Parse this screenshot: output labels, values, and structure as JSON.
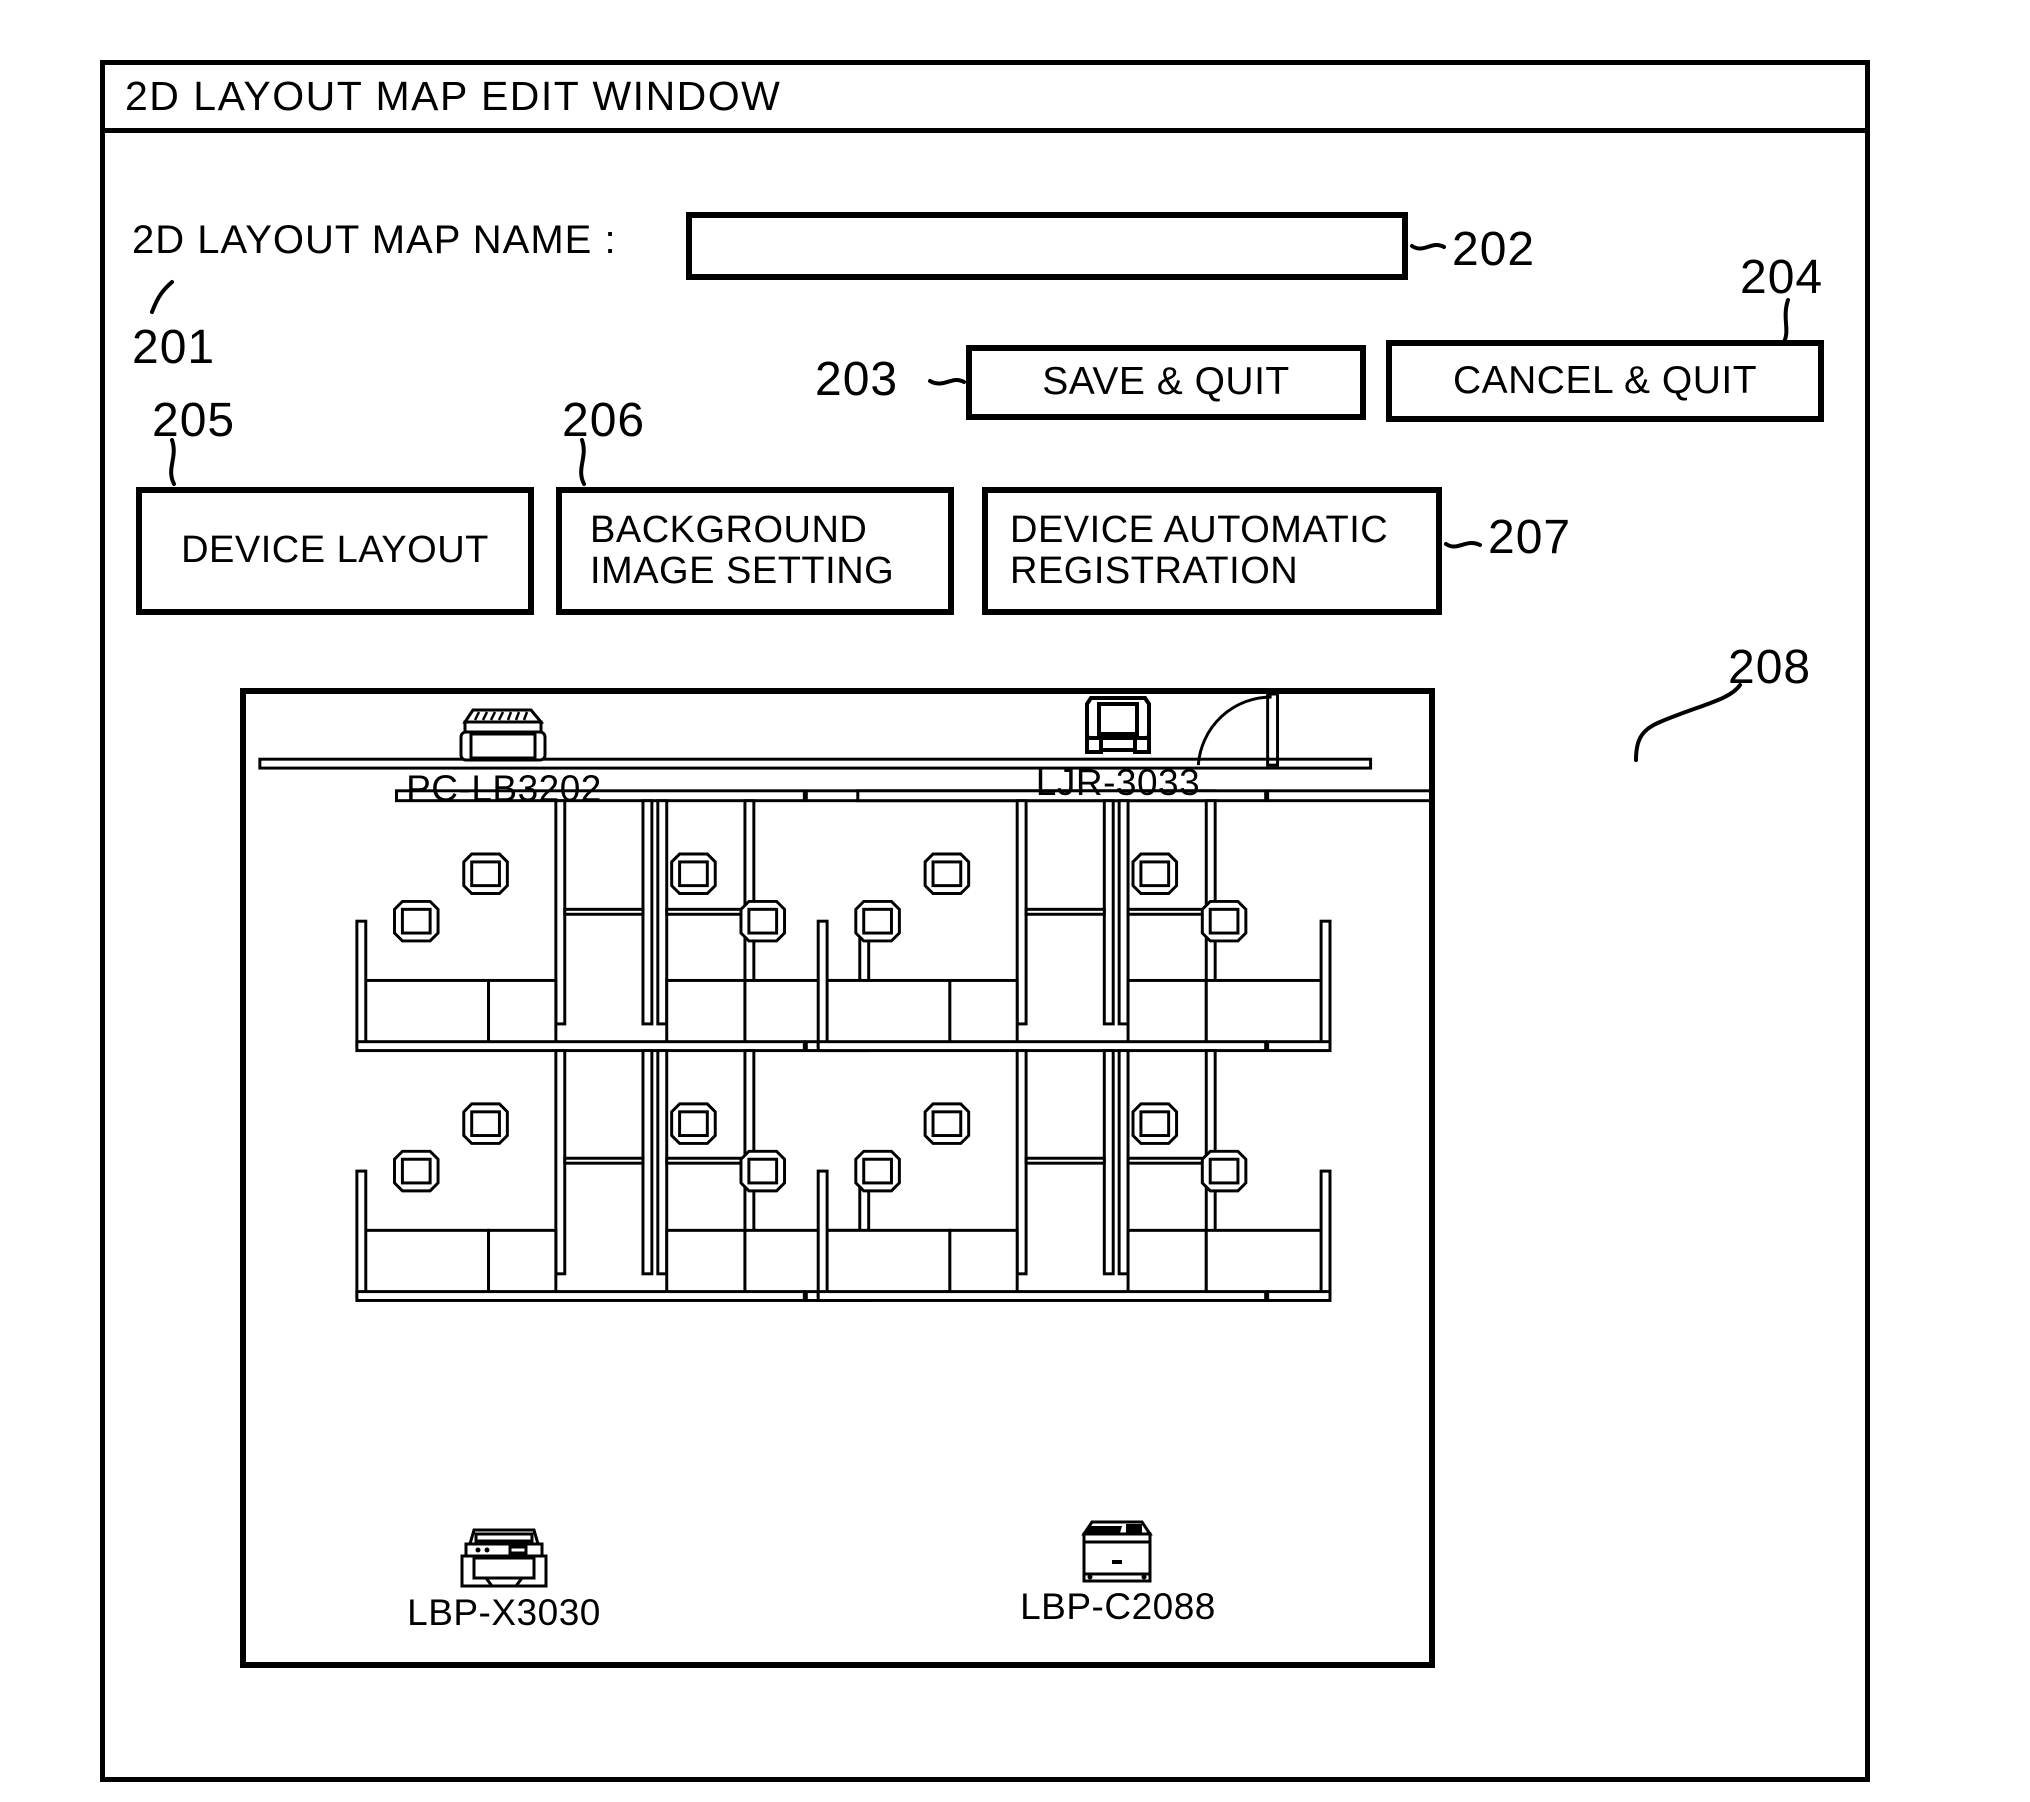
{
  "window": {
    "title": "2D LAYOUT MAP EDIT WINDOW"
  },
  "form": {
    "name_label": "2D LAYOUT MAP NAME :",
    "name_value": "",
    "name_placeholder": ""
  },
  "actions": {
    "save_label": "SAVE & QUIT",
    "cancel_label": "CANCEL & QUIT"
  },
  "tabs": {
    "device_layout": "DEVICE LAYOUT",
    "background_image_line1": "BACKGROUND",
    "background_image_line2": "IMAGE SETTING",
    "device_auto_line1": "DEVICE AUTOMATIC",
    "device_auto_line2": "REGISTRATION"
  },
  "refs": {
    "r201": "201",
    "r202": "202",
    "r203": "203",
    "r204": "204",
    "r205": "205",
    "r206": "206",
    "r207": "207",
    "r208": "208"
  },
  "canvas": {
    "devices": [
      {
        "id": "pc-lb3202",
        "label": "PC-LB3202",
        "icon": "desktop-pc-icon"
      },
      {
        "id": "ljr-3033",
        "label": "LJR-3033",
        "icon": "monitor-icon"
      },
      {
        "id": "lbp-x3030",
        "label": "LBP-X3030",
        "icon": "printer-icon"
      },
      {
        "id": "lbp-c2088",
        "label": "LBP-C2088",
        "icon": "laser-printer-icon"
      }
    ]
  },
  "colors": {
    "line": "#000000",
    "background": "#ffffff"
  }
}
